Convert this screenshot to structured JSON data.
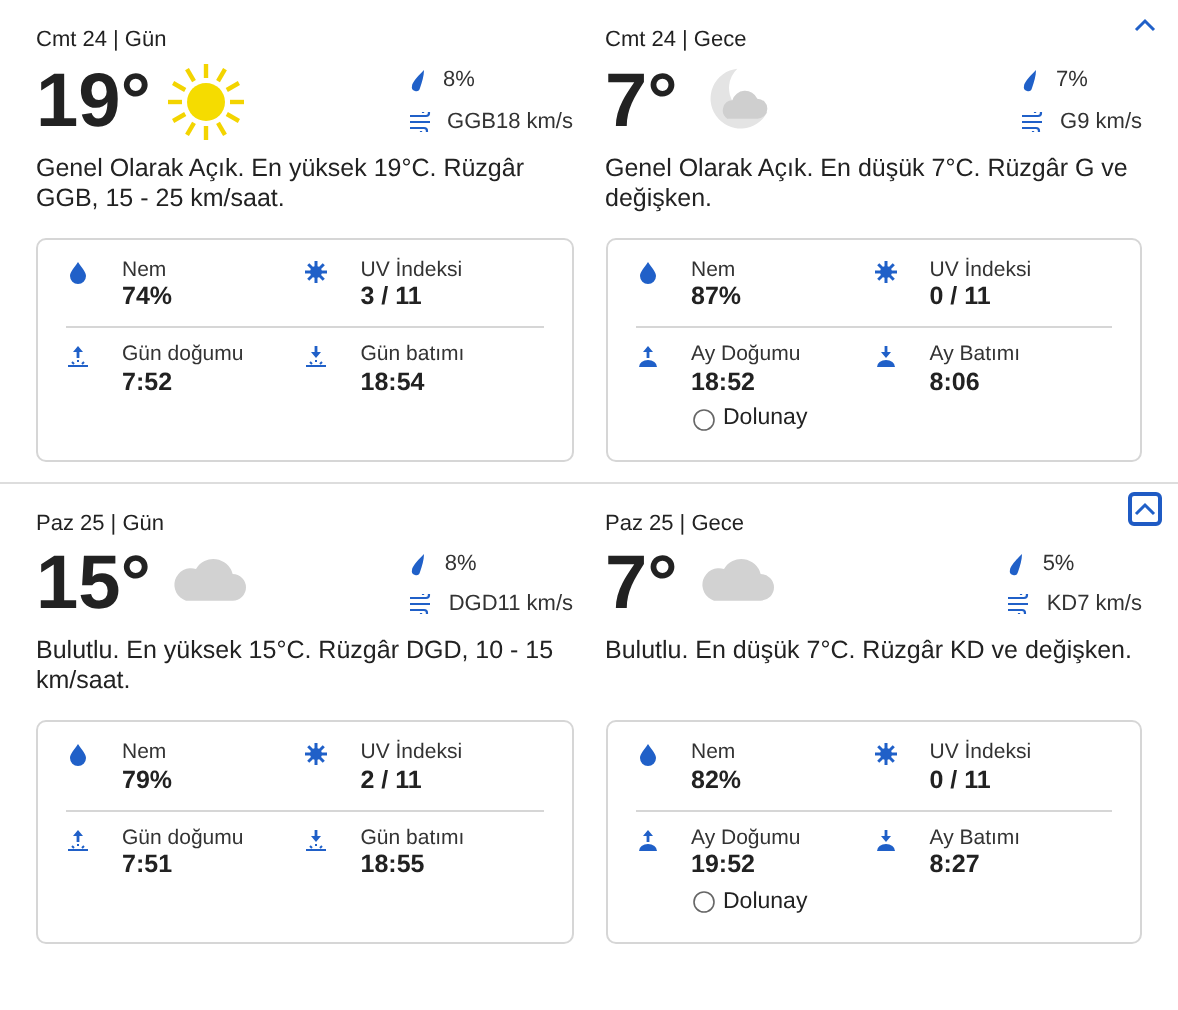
{
  "days": [
    {
      "toggle": {
        "focused": false
      },
      "panels": [
        {
          "header": "Cmt 24 | Gün",
          "temp": "19°",
          "kind": "sun",
          "precip": "8%",
          "wind": "GGB18 km/s",
          "description": "Genel Olarak Açık. En yüksek 19°C. Rüzgâr GGB, 15 - 25 km/saat.",
          "humidity_label": "Nem",
          "humidity": "74%",
          "uv_label": "UV İndeksi",
          "uv": "3 / 11",
          "rise": {
            "kind": "sun",
            "label": "Gün doğumu",
            "time": "7:52"
          },
          "set": {
            "kind": "sun",
            "label": "Gün batımı",
            "time": "18:54"
          }
        },
        {
          "header": "Cmt 24 | Gece",
          "temp": "7°",
          "kind": "moon",
          "precip": "7%",
          "wind": "G9 km/s",
          "description": "Genel Olarak Açık. En düşük 7°C. Rüzgâr G ve değişken.",
          "humidity_label": "Nem",
          "humidity": "87%",
          "uv_label": "UV İndeksi",
          "uv": "0 / 11",
          "rise": {
            "kind": "moon",
            "label": "Ay Doğumu",
            "time": "18:52"
          },
          "set": {
            "kind": "moon",
            "label": "Ay Batımı",
            "time": "8:06"
          },
          "moon_phase": "Dolunay"
        }
      ]
    },
    {
      "toggle": {
        "focused": true
      },
      "panels": [
        {
          "header": "Paz 25 | Gün",
          "temp": "15°",
          "kind": "cloud",
          "precip": "8%",
          "wind": "DGD11 km/s",
          "description": "Bulutlu. En yüksek 15°C. Rüzgâr DGD, 10 - 15 km/saat.",
          "humidity_label": "Nem",
          "humidity": "79%",
          "uv_label": "UV İndeksi",
          "uv": "2 / 11",
          "rise": {
            "kind": "sun",
            "label": "Gün doğumu",
            "time": "7:51"
          },
          "set": {
            "kind": "sun",
            "label": "Gün batımı",
            "time": "18:55"
          }
        },
        {
          "header": "Paz 25 | Gece",
          "temp": "7°",
          "kind": "cloud",
          "precip": "5%",
          "wind": "KD7 km/s",
          "description": "Bulutlu. En düşük 7°C. Rüzgâr KD ve değişken.",
          "humidity_label": "Nem",
          "humidity": "82%",
          "uv_label": "UV İndeksi",
          "uv": "0 / 11",
          "rise": {
            "kind": "moon",
            "label": "Ay Doğumu",
            "time": "19:52"
          },
          "set": {
            "kind": "moon",
            "label": "Ay Batımı",
            "time": "8:27"
          },
          "moon_phase": "Dolunay"
        }
      ]
    }
  ]
}
